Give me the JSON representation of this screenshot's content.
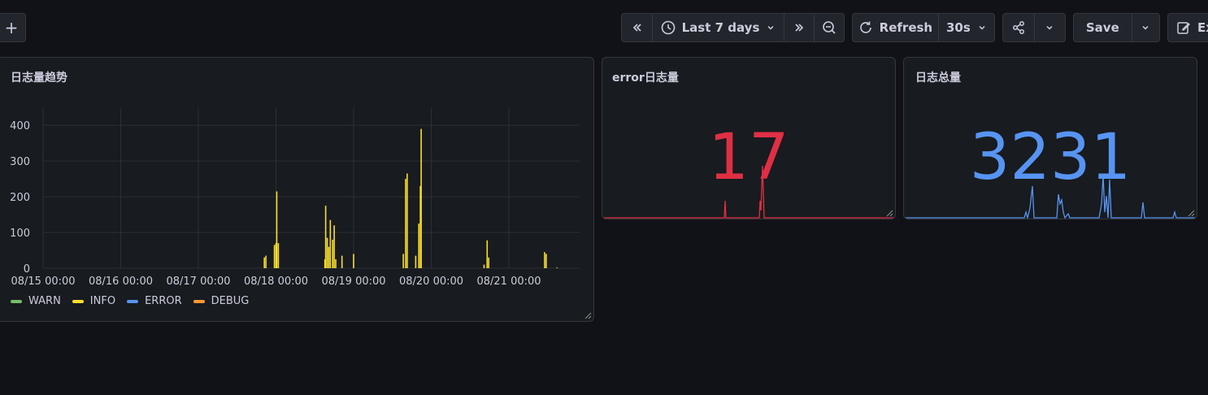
{
  "toolbar": {
    "add_label": "+",
    "time_range": "Last 7 days",
    "refresh_label": "Refresh",
    "refresh_interval": "30s",
    "save_label": "Save",
    "edit_label": "Ex"
  },
  "panels": {
    "trend": {
      "title": "日志量趋势",
      "legend": [
        {
          "name": "WARN",
          "color": "#73bf69"
        },
        {
          "name": "INFO",
          "color": "#fade2a"
        },
        {
          "name": "ERROR",
          "color": "#5794f2"
        },
        {
          "name": "DEBUG",
          "color": "#ff9830"
        }
      ]
    },
    "error": {
      "title": "error日志量",
      "value": "17",
      "color": "#e02f44"
    },
    "total": {
      "title": "日志总量",
      "value": "3231",
      "color": "#5794f2"
    }
  },
  "chart_data": {
    "type": "bar",
    "title": "日志量趋势",
    "ylim": [
      0,
      430
    ],
    "y_ticks": [
      0,
      100,
      200,
      300,
      400
    ],
    "x_ticks": [
      "08/15 00:00",
      "08/16 00:00",
      "08/17 00:00",
      "08/18 00:00",
      "08/19 00:00",
      "08/20 00:00",
      "08/21 00:00"
    ],
    "x_range_days": [
      0,
      6.95
    ],
    "grid": true,
    "legend_position": "bottom-left",
    "series": [
      {
        "name": "INFO",
        "color": "#fade2a",
        "points": [
          [
            2.85,
            30
          ],
          [
            2.87,
            35
          ],
          [
            2.98,
            65
          ],
          [
            3.0,
            70
          ],
          [
            3.01,
            215
          ],
          [
            3.03,
            70
          ],
          [
            3.63,
            25
          ],
          [
            3.64,
            175
          ],
          [
            3.66,
            85
          ],
          [
            3.68,
            60
          ],
          [
            3.7,
            135
          ],
          [
            3.73,
            80
          ],
          [
            3.75,
            120
          ],
          [
            3.77,
            25
          ],
          [
            3.85,
            35
          ],
          [
            4.0,
            40
          ],
          [
            4.64,
            40
          ],
          [
            4.67,
            250
          ],
          [
            4.69,
            265
          ],
          [
            4.8,
            35
          ],
          [
            4.84,
            125
          ],
          [
            4.86,
            230
          ],
          [
            4.87,
            390
          ],
          [
            5.68,
            10
          ],
          [
            5.72,
            78
          ],
          [
            5.74,
            30
          ],
          [
            6.46,
            45
          ],
          [
            6.48,
            40
          ],
          [
            6.62,
            2
          ]
        ]
      }
    ]
  }
}
